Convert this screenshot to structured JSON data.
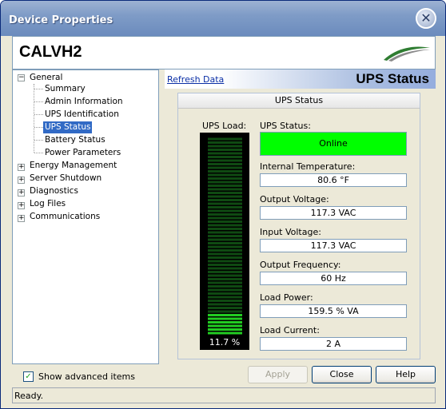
{
  "window": {
    "title": "Device Properties"
  },
  "header": {
    "device_name": "CALVH2",
    "logo_icon": "swoosh-logo-icon"
  },
  "tree": {
    "root_label": "General",
    "general_children": [
      "Summary",
      "Admin Information",
      "UPS Identification",
      "UPS Status",
      "Battery Status",
      "Power Parameters"
    ],
    "selected": "UPS Status",
    "siblings": [
      "Energy Management",
      "Server Shutdown",
      "Diagnostics",
      "Log Files",
      "Communications"
    ]
  },
  "options": {
    "show_advanced_label": "Show advanced items",
    "show_advanced_checked": true
  },
  "panel": {
    "refresh_link": "Refresh Data",
    "title": "UPS Status",
    "group_title": "UPS Status",
    "load_label": "UPS Load:",
    "load_value": "11.7 %",
    "load_fraction": 0.117,
    "fields": [
      {
        "label": "UPS Status:",
        "value": "Online"
      },
      {
        "label": "Internal Temperature:",
        "value": "80.6 °F"
      },
      {
        "label": "Output Voltage:",
        "value": "117.3 VAC"
      },
      {
        "label": "Input Voltage:",
        "value": "117.3 VAC"
      },
      {
        "label": "Output Frequency:",
        "value": "60 Hz"
      },
      {
        "label": "Load Power:",
        "value": "159.5 % VA"
      },
      {
        "label": "Load Current:",
        "value": "2 A"
      }
    ],
    "status_color": "#00ff00"
  },
  "buttons": {
    "apply": "Apply",
    "close": "Close",
    "help": "Help"
  },
  "statusbar": {
    "text": "Ready."
  }
}
